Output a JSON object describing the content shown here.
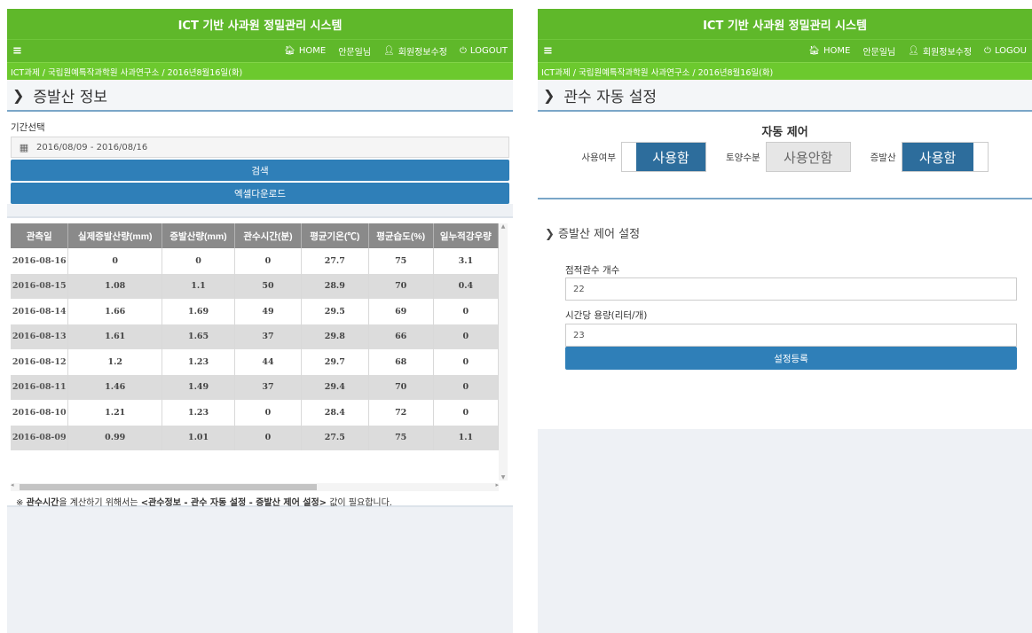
{
  "app": {
    "title": "ICT 기반 사과원 정밀관리 시스템",
    "nav": {
      "menu_icon": "≡",
      "home": "HOME",
      "user": "안문일님",
      "profile": "회원정보수정",
      "logout": "LOGOUT",
      "logout_right": "LOGOU"
    },
    "breadcrumb": "ICT과제 / 국립원예특작과학원 사과연구소 / 2016년8월16일(화)"
  },
  "left": {
    "section_title": "증발산 정보",
    "period_label": "기간선택",
    "date_range": "2016/08/09 - 2016/08/16",
    "search_button": "검색",
    "excel_button": "엑셀다운로드",
    "table": {
      "headers": [
        "관측일",
        "실제증발산량(mm)",
        "증발산량(mm)",
        "관수시간(분)",
        "평균기온(℃)",
        "평균습도(%)",
        "일누적강우량"
      ],
      "rows": [
        [
          "2016-08-16",
          "0",
          "0",
          "0",
          "27.7",
          "75",
          "3.1"
        ],
        [
          "2016-08-15",
          "1.08",
          "1.1",
          "50",
          "28.9",
          "70",
          "0.4"
        ],
        [
          "2016-08-14",
          "1.66",
          "1.69",
          "49",
          "29.5",
          "69",
          "0"
        ],
        [
          "2016-08-13",
          "1.61",
          "1.65",
          "37",
          "29.8",
          "66",
          "0"
        ],
        [
          "2016-08-12",
          "1.2",
          "1.23",
          "44",
          "29.7",
          "68",
          "0"
        ],
        [
          "2016-08-11",
          "1.46",
          "1.49",
          "37",
          "29.4",
          "70",
          "0"
        ],
        [
          "2016-08-10",
          "1.21",
          "1.23",
          "0",
          "28.4",
          "72",
          "0"
        ],
        [
          "2016-08-09",
          "0.99",
          "1.01",
          "0",
          "27.5",
          "75",
          "1.1"
        ]
      ]
    },
    "note_prefix": "※ ",
    "note_bold": "관수시간",
    "note_mid": "을 계산하기 위해서는 ",
    "note_bold2": "<관수정보 - 관수 자동 설정 - 증발산 제어 설정>",
    "note_suffix": " 값이 필요합니다."
  },
  "right": {
    "section_title": "관수 자동 설정",
    "auto_control_title": "자동 제어",
    "toggles": [
      {
        "label": "사용여부",
        "value": "사용함",
        "state": "on"
      },
      {
        "label": "토양수분",
        "value": "사용안함",
        "state": "off"
      },
      {
        "label": "증발산",
        "value": "사용함",
        "state": "on"
      }
    ],
    "evap_section_title": "증발산 제어 설정",
    "drip_label": "점적관수 개수",
    "drip_value": "22",
    "rate_label": "시간당 용량(리터/개)",
    "rate_value": "23",
    "register_button": "설정등록"
  },
  "colors": {
    "header_green": "#5fb82a",
    "breadcrumb_green": "#6cc92e",
    "button_blue": "#2f7fb8",
    "toggle_on": "#2d6d9c"
  }
}
